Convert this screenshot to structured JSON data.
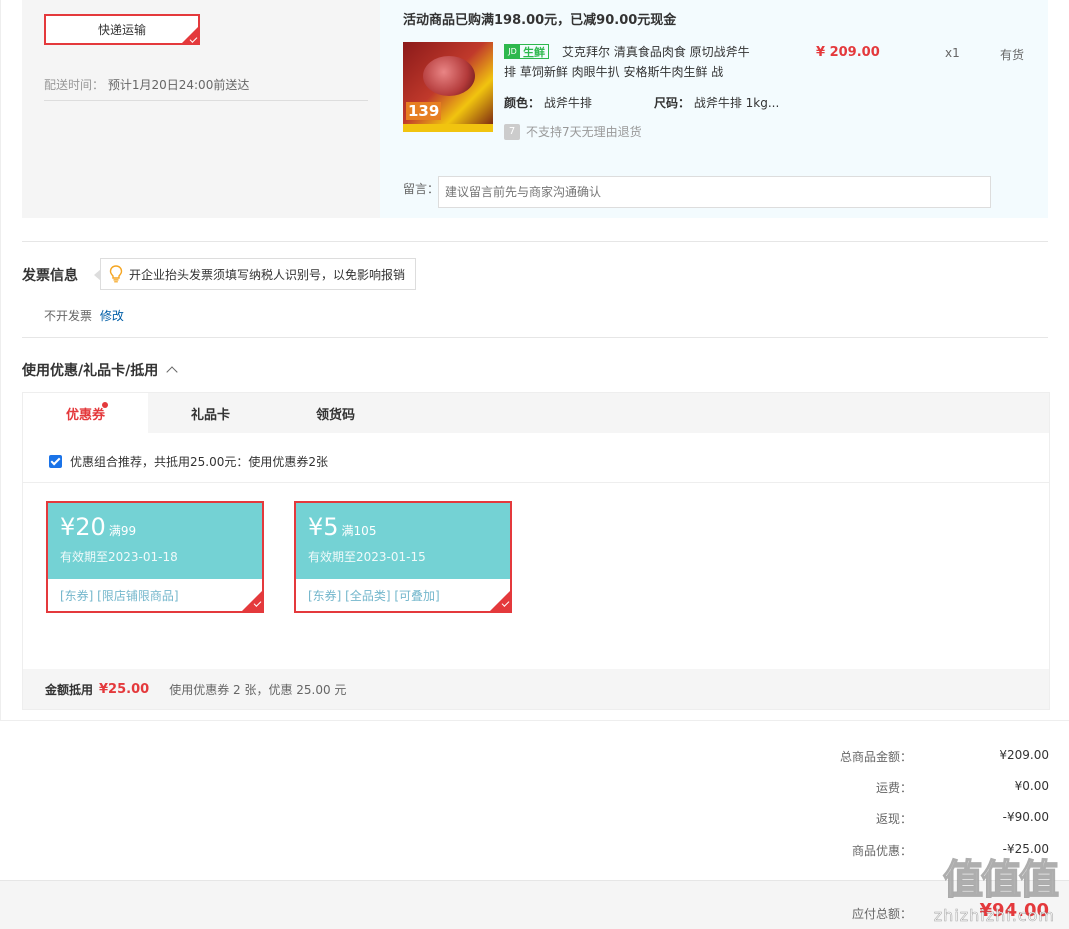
{
  "shipping": {
    "method_label": "快递运输",
    "delivery_label": "配送时间：",
    "delivery_value": "预计1月20日24:00前送达"
  },
  "order_item": {
    "promo_title": "活动商品已购满198.00元，已减90.00元现金",
    "image_price": "139",
    "badge_icon": "JD",
    "badge_text": "生鲜",
    "name": "艾克拜尔 清真食品肉食 原切战斧牛排 草饲新鲜 肉眼牛扒 安格斯牛肉生鲜 战",
    "price": "¥ 209.00",
    "qty": "x1",
    "stock": "有货",
    "color_label": "颜色：",
    "color_value": "战斧牛排",
    "size_label": "尺码：",
    "size_value": "战斧牛排 1kg...",
    "return_icon": "7",
    "return_note": "不支持7天无理由退货",
    "message_label": "留言：",
    "message_placeholder": "建议留言前先与商家沟通确认"
  },
  "invoice": {
    "title": "发票信息",
    "tip": "开企业抬头发票须填写纳税人识别号，以免影响报销",
    "value": "不开发票",
    "edit_label": "修改"
  },
  "coupons": {
    "title": "使用优惠/礼品卡/抵用",
    "tabs": [
      {
        "label": "优惠券"
      },
      {
        "label": "礼品卡"
      },
      {
        "label": "领货码"
      }
    ],
    "recommend_text": "优惠组合推荐，共抵用25.00元：使用优惠券2张",
    "items": [
      {
        "amount": "¥20",
        "condition": "满99",
        "expire": "有效期至2023-01-18",
        "tags": "[东券] [限店铺限商品]"
      },
      {
        "amount": "¥5",
        "condition": "满105",
        "expire": "有效期至2023-01-15",
        "tags": "[东券] [全品类] [可叠加]"
      }
    ],
    "footer_label": "金额抵用",
    "footer_amount": "¥25.00",
    "footer_desc": "使用优惠券 2 张，优惠 25.00 元"
  },
  "summary": {
    "rows": [
      {
        "label": "总商品金额：",
        "value": "¥209.00"
      },
      {
        "label": "运费：",
        "value": "¥0.00"
      },
      {
        "label": "返现：",
        "value": "-¥90.00"
      },
      {
        "label": "商品优惠：",
        "value": "-¥25.00"
      }
    ],
    "total_label": "应付总额：",
    "total_value": "¥94.00"
  },
  "watermark": {
    "logo": "值值值",
    "url": "zhizhizhi.com"
  },
  "colors": {
    "accent_red": "#e4393c",
    "coupon_teal": "#74d2d4",
    "link_blue": "#005ea7",
    "fresh_green": "#2db84d"
  }
}
